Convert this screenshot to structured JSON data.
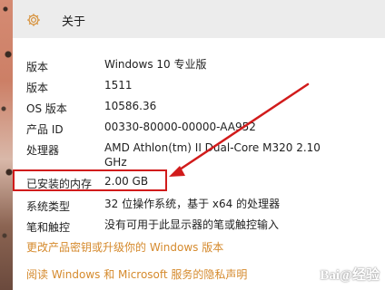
{
  "header": {
    "title": "关于",
    "icon": "gear-icon"
  },
  "spec": [
    {
      "label": "版本",
      "value": "Windows 10 专业版"
    },
    {
      "label": "版本",
      "value": "1511"
    },
    {
      "label": "OS 版本",
      "value": "10586.36"
    },
    {
      "label": "产品 ID",
      "value": "00330-80000-00000-AA952"
    },
    {
      "label": "处理器",
      "value_line1": "AMD Athlon(tm) II Dual-Core M320   2.10",
      "value_line2": "GHz"
    },
    {
      "label": "已安装的内存",
      "value": "2.00 GB"
    },
    {
      "label": "系统类型",
      "value": "32 位操作系统，基于 x64 的处理器"
    },
    {
      "label": "笔和触控",
      "value": "没有可用于此显示器的笔或触控输入"
    }
  ],
  "links": {
    "change_key": "更改产品密钥或升级你的 Windows 版本",
    "privacy": "阅读 Windows 和 Microsoft 服务的隐私声明"
  },
  "watermark": "Bai@经验",
  "colors": {
    "header_bg": "#ececec",
    "link": "#d58a2d",
    "annotation_red": "#d11b1b"
  }
}
